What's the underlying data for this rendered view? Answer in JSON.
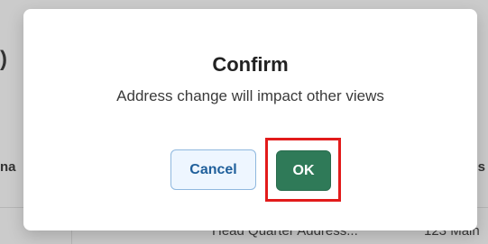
{
  "background": {
    "paren_text": ")",
    "left_header_text": "na",
    "right_header_text": "s",
    "row_cell_1": "Head Quarter Address...",
    "row_cell_2": "123 Main"
  },
  "modal": {
    "title": "Confirm",
    "message": "Address change will impact other views",
    "buttons": {
      "cancel_label": "Cancel",
      "ok_label": "OK"
    },
    "highlight_color": "#e21b1b"
  },
  "colors": {
    "ok_button": "#2f7a58",
    "cancel_text": "#1f5f9b",
    "cancel_border": "#8fb8df",
    "highlight": "#e21b1b"
  }
}
